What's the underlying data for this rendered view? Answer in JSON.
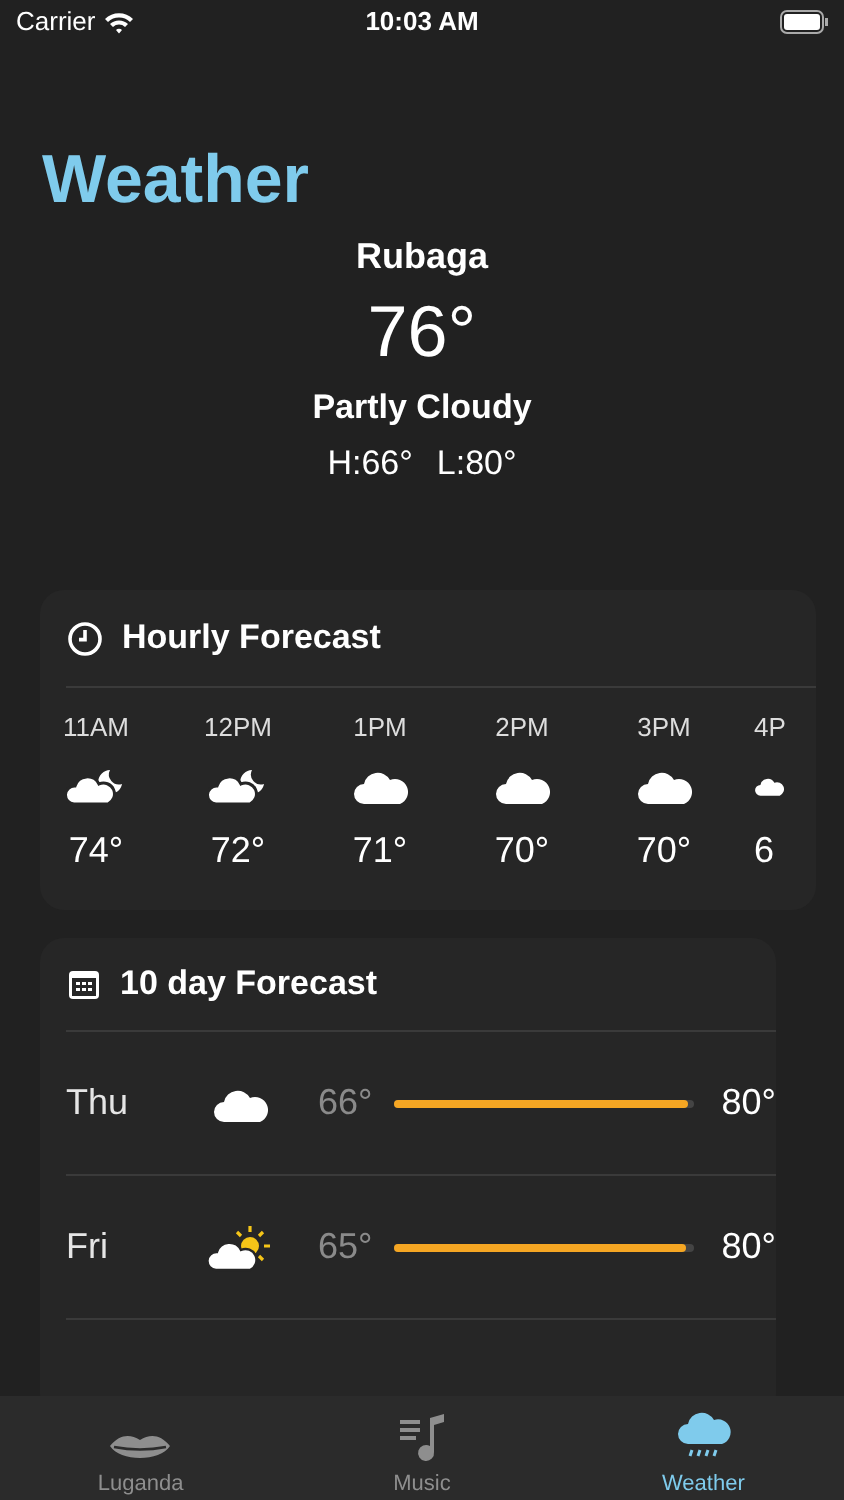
{
  "status_bar": {
    "carrier": "Carrier",
    "time": "10:03 AM"
  },
  "title": "Weather",
  "current": {
    "city": "Rubaga",
    "temperature": "76°",
    "condition": "Partly Cloudy",
    "high": "H:66°",
    "low": "L:80°"
  },
  "hourly": {
    "title": "Hourly Forecast",
    "items": [
      {
        "time": "11AM",
        "kind": "partly-cloudy-night",
        "temp": "74°"
      },
      {
        "time": "12PM",
        "kind": "partly-cloudy-night",
        "temp": "72°"
      },
      {
        "time": "1PM",
        "kind": "cloudy",
        "temp": "71°"
      },
      {
        "time": "2PM",
        "kind": "cloudy",
        "temp": "70°"
      },
      {
        "time": "3PM",
        "kind": "cloudy",
        "temp": "70°"
      },
      {
        "time": "4P",
        "kind": "cloudy",
        "temp": "6"
      }
    ]
  },
  "daily": {
    "title": "10 day Forecast",
    "items": [
      {
        "day": "Thu",
        "kind": "cloudy",
        "low": "66°",
        "level": 0.98,
        "high": "80°"
      },
      {
        "day": "Fri",
        "kind": "partly-sunny",
        "low": "65°",
        "level": 0.97,
        "high": "80°"
      }
    ]
  },
  "tabs": [
    {
      "label": "Luganda",
      "kind": "lips",
      "selected": false
    },
    {
      "label": "Music",
      "kind": "music",
      "selected": false
    },
    {
      "label": "Weather",
      "kind": "rain",
      "selected": true
    }
  ]
}
